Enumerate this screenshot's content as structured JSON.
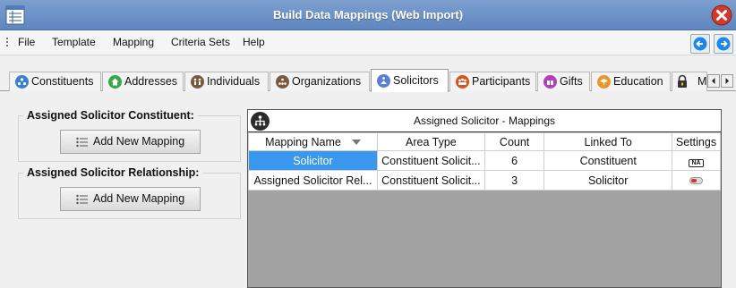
{
  "window": {
    "title": "Build Data Mappings (Web Import)"
  },
  "menu": [
    "File",
    "Template",
    "Mapping",
    "Criteria Sets",
    "Help"
  ],
  "tabs": [
    {
      "label": "Constituents",
      "icon": "constituents-icon",
      "color": "#3a7fd0"
    },
    {
      "label": "Addresses",
      "icon": "home-icon",
      "color": "#3aa64a"
    },
    {
      "label": "Individuals",
      "icon": "people-icon",
      "color": "#7a5a3f"
    },
    {
      "label": "Organizations",
      "icon": "organization-icon",
      "color": "#7a5a3f"
    },
    {
      "label": "Solicitors",
      "icon": "solicitors-icon",
      "color": "#5b7fd6",
      "active": true
    },
    {
      "label": "Participants",
      "icon": "participants-icon",
      "color": "#d2551f"
    },
    {
      "label": "Gifts",
      "icon": "gift-icon",
      "color": "#b03fb8"
    },
    {
      "label": "Education",
      "icon": "education-icon",
      "color": "#e8962a"
    },
    {
      "label": "Me",
      "icon": "lock-icon",
      "color": "#333333"
    }
  ],
  "left": {
    "constituent_group": {
      "label": "Assigned Solicitor Constituent:",
      "button": "Add New Mapping"
    },
    "relationship_group": {
      "label": "Assigned Solicitor Relationship:",
      "button": "Add New Mapping"
    }
  },
  "grid": {
    "title": "Assigned Solicitor - Mappings",
    "columns": [
      "Mapping Name",
      "Area Type",
      "Count",
      "Linked To",
      "Settings"
    ],
    "rows": [
      {
        "name": "Solicitor",
        "area": "Constituent Solicit...",
        "count": "6",
        "linked": "Constituent",
        "setting": "NA"
      },
      {
        "name": "Assigned Solicitor Rel...",
        "area": "Constituent Solicit...",
        "count": "3",
        "linked": "Solicitor",
        "setting": "toggle"
      }
    ]
  },
  "colors": {
    "selection": "#3a97ee",
    "title_bar": "#6b8fc6",
    "close_button": "#d13a2a",
    "nav_arrow": "#1e86e8"
  }
}
